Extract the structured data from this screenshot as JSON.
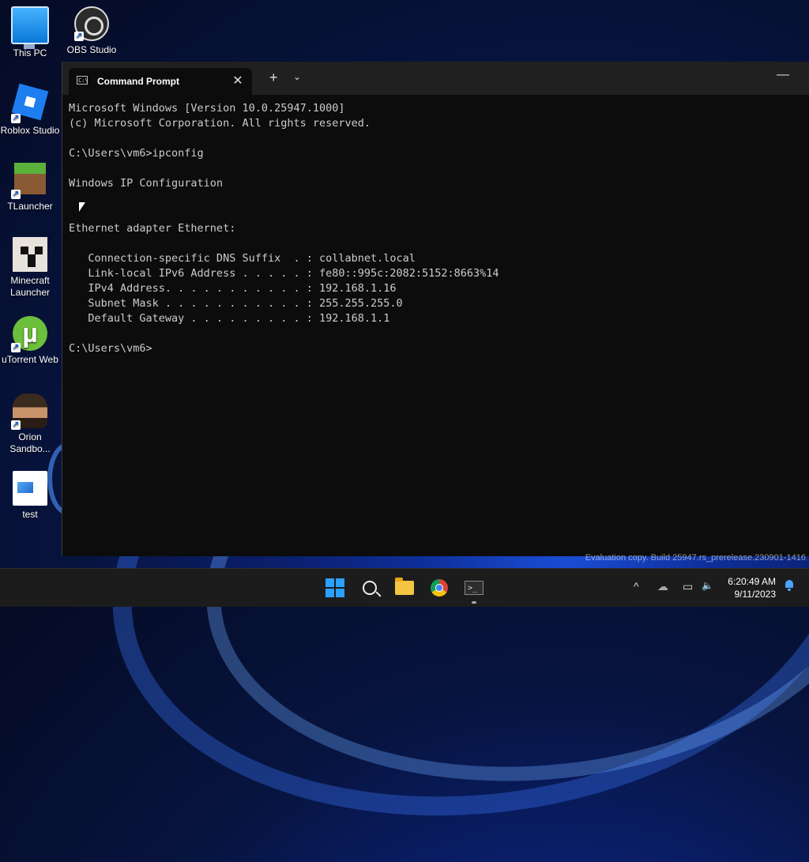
{
  "desktop": {
    "icons": [
      {
        "label": "This PC",
        "icon": "computer-icon"
      },
      {
        "label": "OBS Studio",
        "icon": "obs-icon"
      },
      {
        "label": "Roblox Studio",
        "icon": "roblox-icon"
      },
      {
        "label": "TLauncher",
        "icon": "grass-block-icon"
      },
      {
        "label": "Minecraft Launcher",
        "icon": "creeper-icon"
      },
      {
        "label": "uTorrent Web",
        "icon": "utorrent-icon"
      },
      {
        "label": "Orion Sandbo...",
        "icon": "orion-icon"
      },
      {
        "label": "test",
        "icon": "image-file-icon"
      }
    ],
    "watermark": "Evaluation copy. Build 25947.rs_prerelease.230901-1416"
  },
  "terminal": {
    "tab_title": "Command Prompt",
    "tab_icon_text": "C:\\",
    "new_tab_label": "+",
    "close_label": "✕",
    "menu_label": "⌄",
    "minimize_label": "—",
    "lines": [
      "Microsoft Windows [Version 10.0.25947.1000]",
      "(c) Microsoft Corporation. All rights reserved.",
      "",
      "C:\\Users\\vm6>ipconfig",
      "",
      "Windows IP Configuration",
      "",
      "",
      "Ethernet adapter Ethernet:",
      "",
      "   Connection-specific DNS Suffix  . : collabnet.local",
      "   Link-local IPv6 Address . . . . . : fe80::995c:2082:5152:8663%14",
      "   IPv4 Address. . . . . . . . . . . : 192.168.1.16",
      "   Subnet Mask . . . . . . . . . . . : 255.255.255.0",
      "   Default Gateway . . . . . . . . . : 192.168.1.1",
      "",
      "C:\\Users\\vm6>"
    ]
  },
  "taskbar": {
    "apps": [
      "start-icon",
      "search-icon",
      "file-explorer-icon",
      "chrome-icon",
      "terminal-icon"
    ],
    "terminal_icon_text": ">_",
    "tray": {
      "overflow": "^",
      "onedrive": "☁",
      "network": "▭",
      "volume": "🔈"
    },
    "time": "6:20:49 AM",
    "date": "9/11/2023"
  }
}
